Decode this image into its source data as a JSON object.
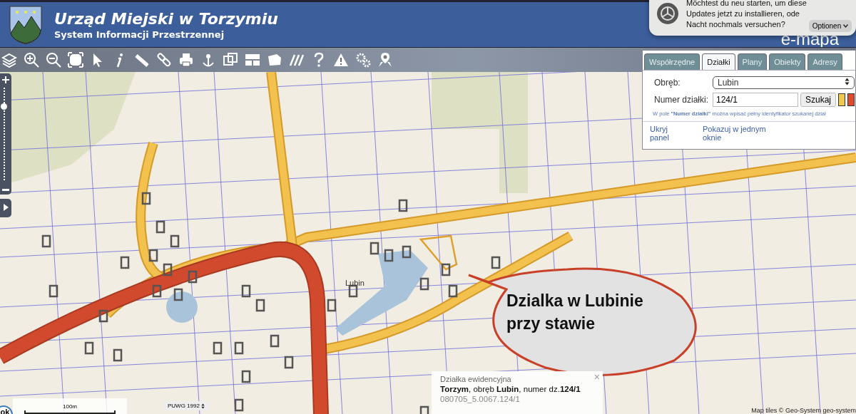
{
  "header": {
    "title": "Urząd Miejski w Torzymiu",
    "subtitle": "System Informacji Przestrzennej",
    "brand": "e-mapa"
  },
  "notification": {
    "lines": [
      "Möchtest du neu starten, um diese",
      "Updates jetzt zu installieren, ode",
      "Nacht nochmals versuchen?"
    ],
    "button": "Optionen"
  },
  "zoom_slider": {
    "level": 0.8
  },
  "search_panel": {
    "tabs": [
      {
        "label": "Współrzędne",
        "selected": false
      },
      {
        "label": "Działki",
        "selected": true
      },
      {
        "label": "Plany",
        "selected": false
      },
      {
        "label": "Obiekty",
        "selected": false
      },
      {
        "label": "Adresy",
        "selected": false
      }
    ],
    "precinct_label": "Obręb:",
    "precinct_value": "Lubin",
    "number_label": "Numer działki:",
    "number_value": "124/1",
    "search_button": "Szukaj",
    "swatches": [
      {
        "color": "#f0c850"
      },
      {
        "color": "#e04a2a"
      }
    ],
    "hint": "W pole **\"Numer działki\"** można wpisać pełny identyfikator szukanej dział",
    "footer_links": [
      "Ukryj panel",
      "Pokazuj w jednym oknie"
    ]
  },
  "map": {
    "place_label": "Lubin",
    "callout": "Dzialka w Lubinie przy stawie",
    "scale": "100m",
    "projection": "PUWG 1992",
    "attribution": "Map tiles © Geo-System geo-system",
    "ok_button": "ok"
  },
  "parcel_popup": {
    "title": "Działka ewidencyjna",
    "details": "**Torzym**, obręb **Lubin**, numer dz.**124/1**",
    "identifier": "080705_5.0067.124/1",
    "close": "×"
  }
}
